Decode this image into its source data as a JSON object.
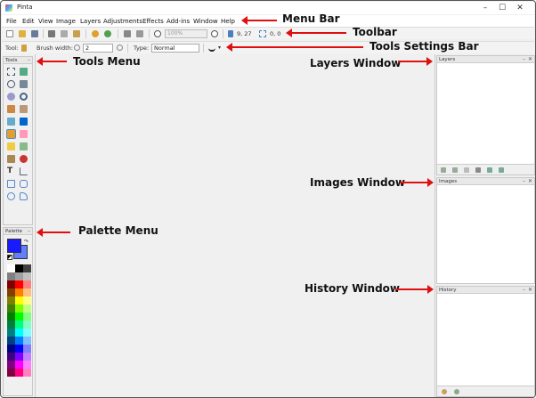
{
  "app": {
    "title": "Pinta"
  },
  "window_controls": {
    "minimize": "–",
    "maximize": "☐",
    "close": "✕"
  },
  "menu": [
    "File",
    "Edit",
    "View",
    "Image",
    "Layers",
    "Adjustments",
    "Effects",
    "Add-ins",
    "Window",
    "Help"
  ],
  "toolbar": {
    "zoom_value": "100%",
    "cursor_position": "9, 27",
    "selection_size": "0, 0"
  },
  "tool_settings": {
    "tool_label": "Tool:",
    "brush_width_label": "Brush width:",
    "brush_width_value": "2",
    "type_label": "Type:",
    "type_value": "Normal"
  },
  "panels": {
    "tools": "Tools",
    "palette": "Palette",
    "layers": "Layers",
    "images": "Images",
    "history": "History"
  },
  "palette": {
    "primary_color": "#1a1aff",
    "secondary_color": "#6080ff",
    "colors": [
      "#ffffff",
      "#000000",
      "#404040",
      "#808080",
      "#a0a0a0",
      "#c0c0c0",
      "#800000",
      "#ff0000",
      "#ff8080",
      "#804000",
      "#ff8000",
      "#ffc080",
      "#808000",
      "#ffff00",
      "#ffff80",
      "#408000",
      "#80ff00",
      "#c0ff80",
      "#008000",
      "#00ff00",
      "#80ff80",
      "#008040",
      "#00ff80",
      "#80ffc0",
      "#008080",
      "#00ffff",
      "#80ffff",
      "#004080",
      "#0080ff",
      "#80c0ff",
      "#000080",
      "#0000ff",
      "#8080ff",
      "#400080",
      "#8000ff",
      "#c080ff",
      "#800080",
      "#ff00ff",
      "#ff80ff",
      "#800040",
      "#ff0080",
      "#ff80c0"
    ]
  },
  "annotations": {
    "menu_bar": "Menu Bar",
    "toolbar": "Toolbar",
    "tools_settings_bar": "Tools Settings Bar",
    "tools_menu": "Tools Menu",
    "layers_window": "Layers Window",
    "images_window": "Images Window",
    "palette_menu": "Palette Menu",
    "history_window": "History Window"
  },
  "colors": {
    "annotation_arrow": "#e01010"
  }
}
